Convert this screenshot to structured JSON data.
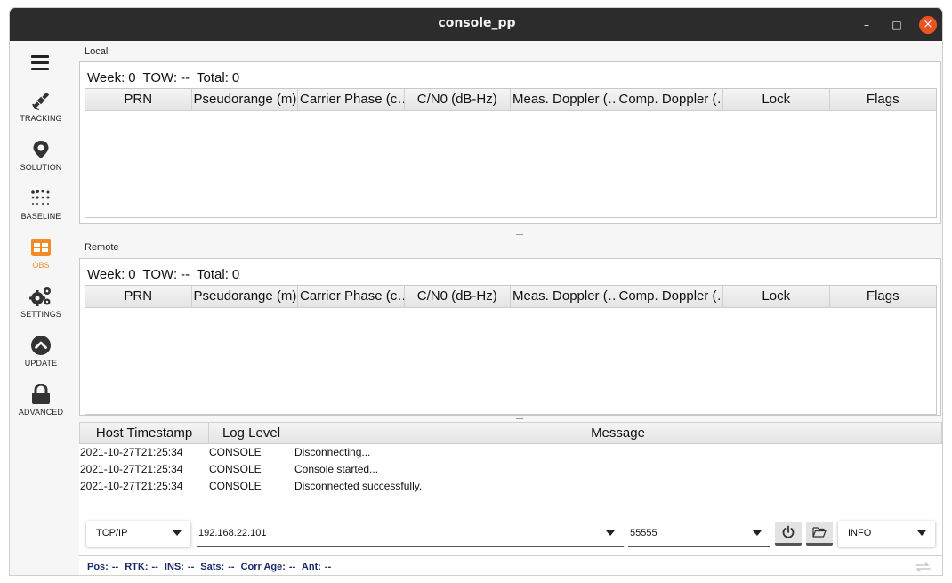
{
  "window": {
    "title": "console_pp",
    "minimize": "–",
    "maximize": "□",
    "close": "×"
  },
  "sidebar": {
    "items": [
      {
        "label": "TRACKING",
        "icon": "satellite-icon",
        "active": false
      },
      {
        "label": "SOLUTION",
        "icon": "map-pin-icon",
        "active": false
      },
      {
        "label": "BASELINE",
        "icon": "dots-grid-icon",
        "active": false
      },
      {
        "label": "OBS",
        "icon": "table-icon",
        "active": true
      },
      {
        "label": "SETTINGS",
        "icon": "gears-icon",
        "active": false
      },
      {
        "label": "UPDATE",
        "icon": "chevron-up-circle-icon",
        "active": false
      },
      {
        "label": "ADVANCED",
        "icon": "lock-icon",
        "active": false
      }
    ],
    "accent_color": "#f28c28"
  },
  "local": {
    "title": "Local",
    "week_label": "Week:",
    "week_value": "0",
    "tow_label": "TOW:",
    "tow_value": "--",
    "total_label": "Total:",
    "total_value": "0"
  },
  "remote": {
    "title": "Remote",
    "week_label": "Week:",
    "week_value": "0",
    "tow_label": "TOW:",
    "tow_value": "--",
    "total_label": "Total:",
    "total_value": "0"
  },
  "obs_columns": [
    "PRN",
    "Pseudorange (m)",
    "Carrier Phase (c…",
    "C/N0 (dB-Hz)",
    "Meas. Doppler (…",
    "Comp. Doppler (…",
    "Lock",
    "Flags"
  ],
  "log": {
    "columns": [
      "Host Timestamp",
      "Log Level",
      "Message"
    ],
    "rows": [
      {
        "timestamp": "2021-10-27T21:25:34",
        "level": "CONSOLE",
        "message": "Disconnecting..."
      },
      {
        "timestamp": "2021-10-27T21:25:34",
        "level": "CONSOLE",
        "message": "Console started..."
      },
      {
        "timestamp": "2021-10-27T21:25:34",
        "level": "CONSOLE",
        "message": "Disconnected successfully."
      }
    ]
  },
  "connection": {
    "type": "TCP/IP",
    "host": "192.168.22.101",
    "port": "55555",
    "log_level": "INFO"
  },
  "status": {
    "pos_label": "Pos:",
    "pos_value": "--",
    "rtk_label": "RTK:",
    "rtk_value": "--",
    "ins_label": "INS:",
    "ins_value": "--",
    "sats_label": "Sats:",
    "sats_value": "--",
    "corr_label": "Corr Age:",
    "corr_value": "--",
    "ant_label": "Ant:",
    "ant_value": "--"
  }
}
